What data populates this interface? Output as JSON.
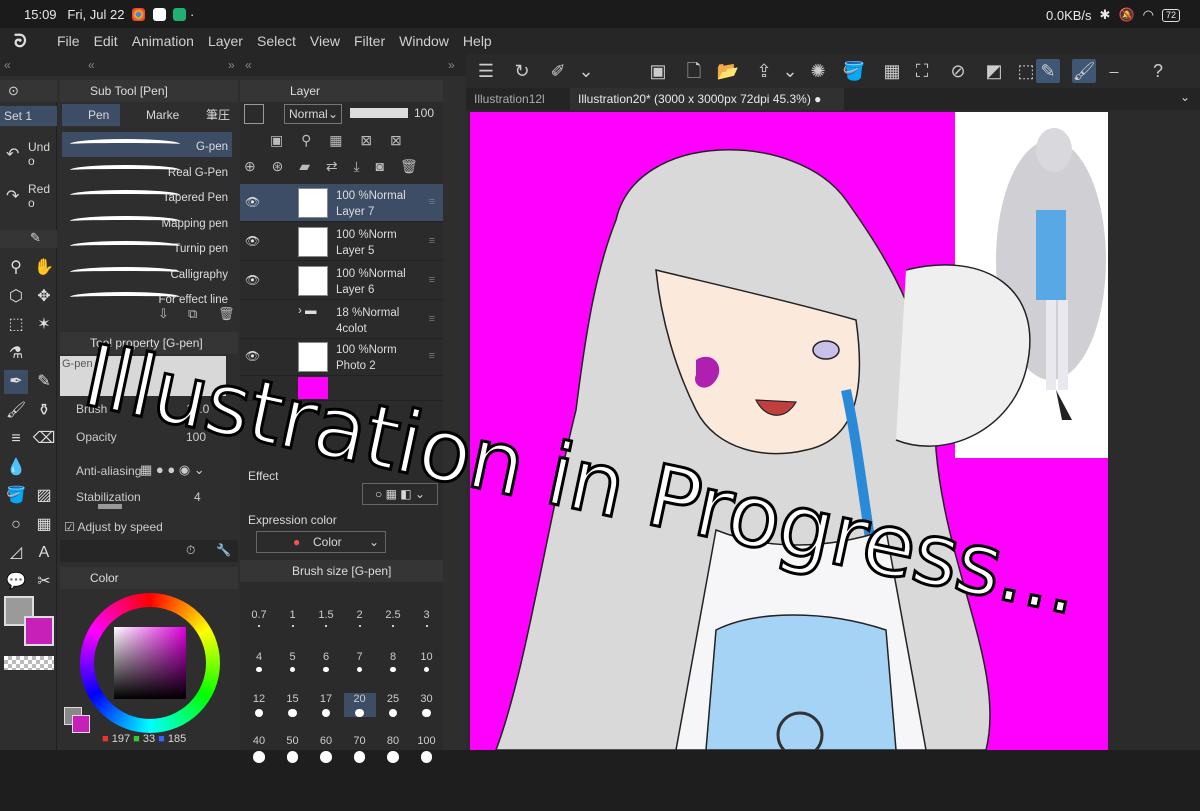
{
  "status": {
    "time": "15:09",
    "date": "Fri, Jul 22",
    "net": "0.0KB/s",
    "battery": "72"
  },
  "menu": [
    "File",
    "Edit",
    "Animation",
    "Layer",
    "Select",
    "View",
    "Filter",
    "Window",
    "Help"
  ],
  "tabs": [
    {
      "label": "Illustration12l"
    },
    {
      "label": "Illustration20* (3000 x 3000px 72dpi 45.3%)"
    }
  ],
  "left_col": {
    "set": "Set 1",
    "undo": "Undo",
    "redo": "Redo"
  },
  "subtool": {
    "title": "Sub Tool [Pen]",
    "tabs": [
      "Pen",
      "Marke",
      "筆圧G"
    ],
    "brushes": [
      "G-pen",
      "Real G-Pen",
      "Tapered Pen",
      "Mapping pen",
      "Turnip pen",
      "Calligraphy",
      "For effect line"
    ]
  },
  "toolprop": {
    "title": "Tool property [G-pen]",
    "preset": "G-pen",
    "rows": [
      {
        "label": "Brush",
        "value": "10.0"
      },
      {
        "label": "Opacity",
        "value": "100"
      },
      {
        "label": "Anti-aliasing",
        "value": ""
      },
      {
        "label": "Stabilization",
        "value": "4"
      }
    ],
    "adjust": "Adjust by speed"
  },
  "layer": {
    "title": "Layer",
    "blend": "Normal",
    "opacity": "100",
    "rows": [
      {
        "pct": "100 %Normal",
        "name": "Layer 7",
        "selected": true
      },
      {
        "pct": "100 %Norm",
        "name": "Layer 5"
      },
      {
        "pct": "100 %Normal",
        "name": "Layer 6"
      },
      {
        "pct": "18 %Normal",
        "name": "4colot"
      },
      {
        "pct": "100 %Norm",
        "name": "Photo 2"
      }
    ],
    "effect_label": "Effect",
    "expr_label": "Expression color",
    "expr_value": "Color"
  },
  "color": {
    "title": "Color",
    "r": "197",
    "g": "33",
    "b": "185",
    "accent": "#c521b9"
  },
  "brush_size": {
    "title": "Brush size [G-pen]",
    "values": [
      "0.7",
      "1",
      "1.5",
      "2",
      "2.5",
      "3",
      "4",
      "5",
      "6",
      "7",
      "8",
      "10",
      "12",
      "15",
      "17",
      "20",
      "25",
      "30",
      "40",
      "50",
      "60",
      "70",
      "80",
      "100"
    ],
    "selected": "20"
  },
  "overlay_text": "Illustration in Progress..."
}
